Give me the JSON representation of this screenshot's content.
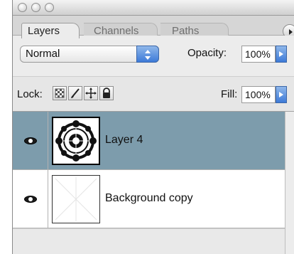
{
  "tabs": [
    "Layers",
    "Channels",
    "Paths"
  ],
  "blend_mode": "Normal",
  "opacity": {
    "label": "Opacity:",
    "value": "100%"
  },
  "lock": {
    "label": "Lock:"
  },
  "fill": {
    "label": "Fill:",
    "value": "100%"
  },
  "layers": [
    {
      "name": "Layer 4",
      "selected": true
    },
    {
      "name": "Background copy",
      "selected": false
    }
  ]
}
